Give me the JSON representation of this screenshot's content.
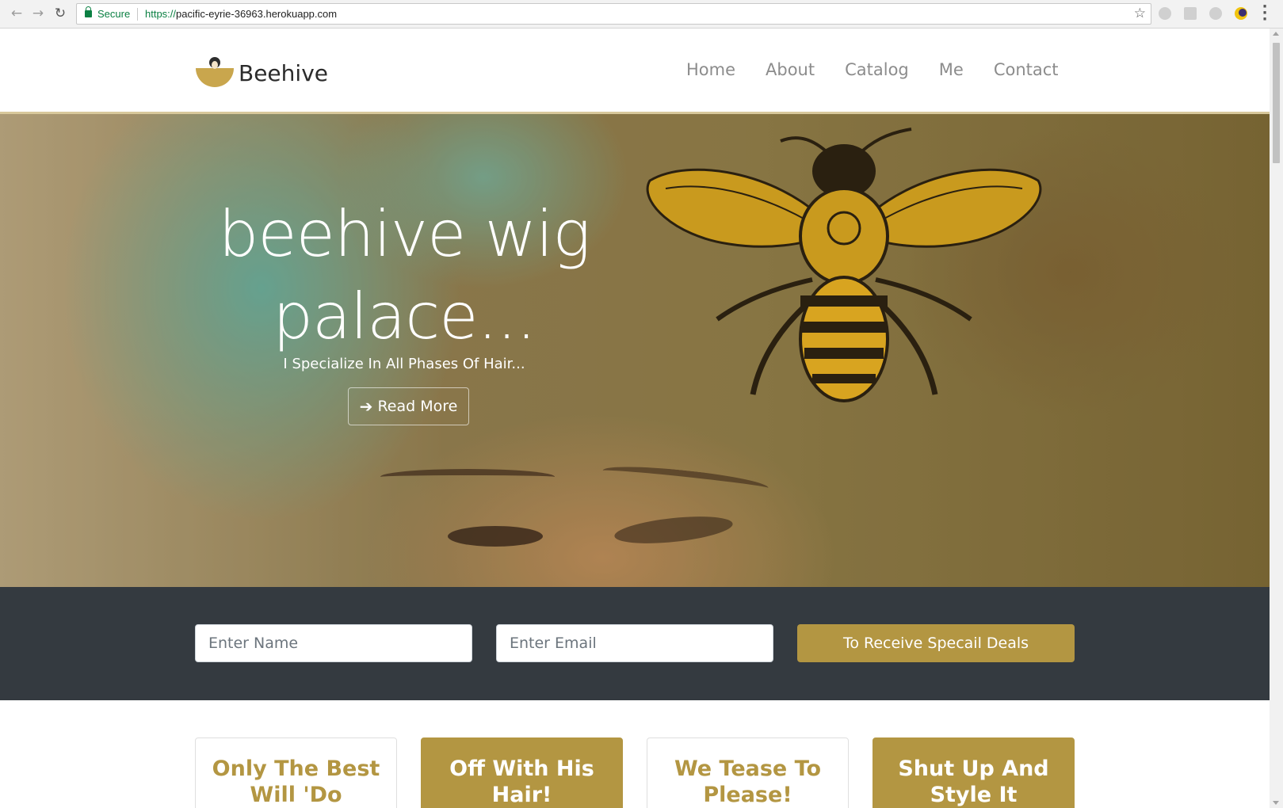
{
  "browser": {
    "secure_label": "Secure",
    "url_scheme": "https://",
    "url_host": "pacific-eyrie-36963.herokuapp.com"
  },
  "site": {
    "brand_name": "Beehive",
    "nav": [
      "Home",
      "About",
      "Catalog",
      "Me",
      "Contact"
    ]
  },
  "hero": {
    "title_line1": "beehive wig",
    "title_line2": "palace...",
    "subtitle": "I Specialize In All Phases Of Hair...",
    "read_more": "Read More"
  },
  "subscribe": {
    "name_placeholder": "Enter Name",
    "email_placeholder": "Enter Email",
    "button_label": "To Receive Specail Deals"
  },
  "cards": [
    {
      "line1": "Only The Best",
      "line2": "Will 'Do"
    },
    {
      "line1": "Off With His",
      "line2": "Hair!"
    },
    {
      "line1": "We Tease To",
      "line2": "Please!"
    },
    {
      "line1": "Shut Up And",
      "line2": "Style It"
    }
  ],
  "colors": {
    "accent_gold": "#b39642",
    "dark_band": "#343a40",
    "secure_green": "#0b8043"
  }
}
